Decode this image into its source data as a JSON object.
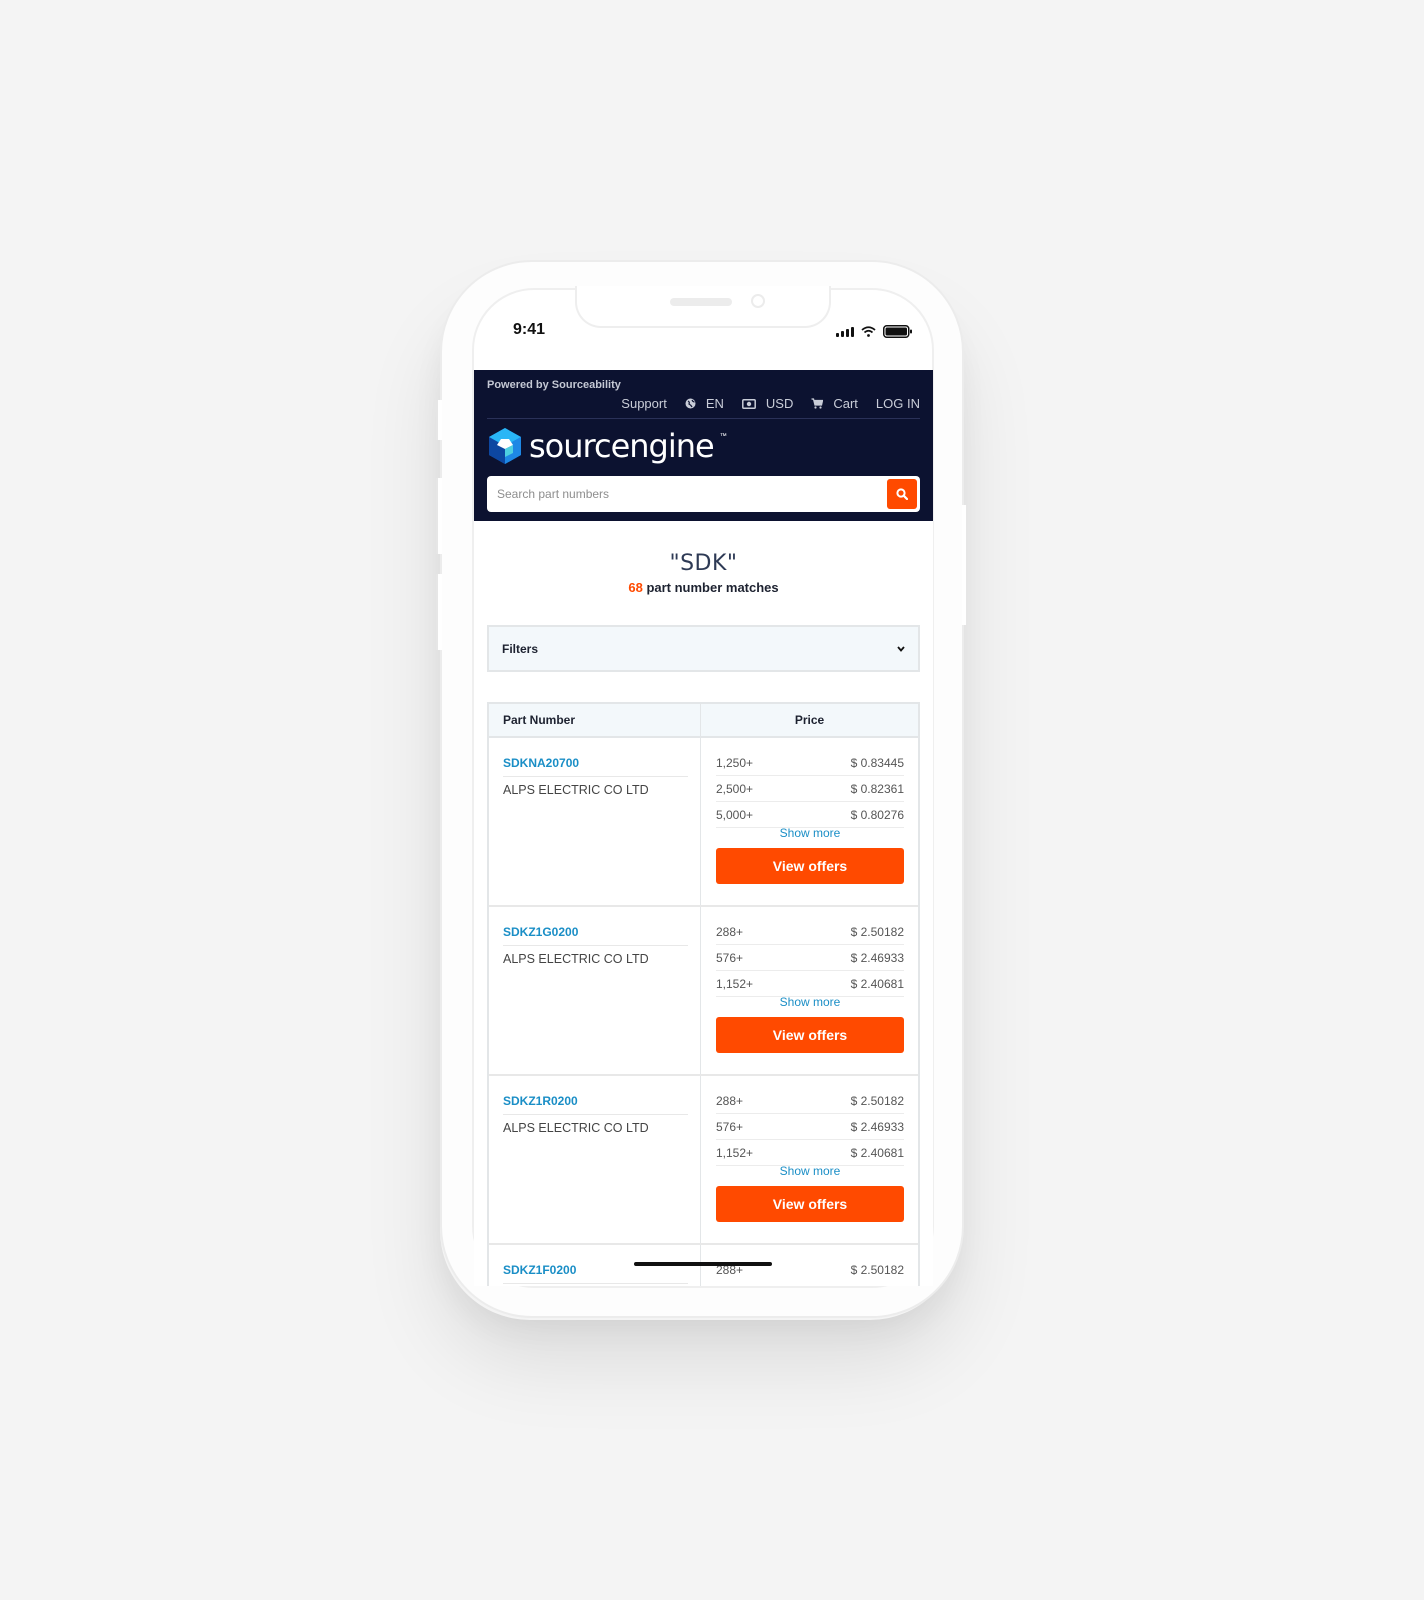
{
  "status_bar": {
    "time": "9:41"
  },
  "header": {
    "powered_by": "Powered by Sourceability",
    "nav": [
      {
        "label": "Support",
        "icon": ""
      },
      {
        "label": "EN",
        "icon": "globe-icon"
      },
      {
        "label": "USD",
        "icon": "money-icon"
      },
      {
        "label": "Cart",
        "icon": "cart-icon"
      },
      {
        "label": "LOG IN",
        "icon": ""
      }
    ],
    "logo_text": "sourcengine",
    "logo_tm": "™",
    "search": {
      "placeholder": "Search part numbers",
      "value": ""
    }
  },
  "results": {
    "query": "\"SDK\"",
    "count": "68",
    "matches_label": "part number matches"
  },
  "filters": {
    "label": "Filters"
  },
  "table": {
    "headers": [
      "Part Number",
      "Price"
    ],
    "show_more_label": "Show more",
    "view_offers_label": "View offers",
    "rows": [
      {
        "part_number": "SDKNA20700",
        "manufacturer": "ALPS ELECTRIC CO LTD",
        "prices": [
          {
            "qty": "1,250+",
            "price": "$ 0.83445"
          },
          {
            "qty": "2,500+",
            "price": "$ 0.82361"
          },
          {
            "qty": "5,000+",
            "price": "$ 0.80276"
          }
        ]
      },
      {
        "part_number": "SDKZ1G0200",
        "manufacturer": "ALPS ELECTRIC CO LTD",
        "prices": [
          {
            "qty": "288+",
            "price": "$ 2.50182"
          },
          {
            "qty": "576+",
            "price": "$ 2.46933"
          },
          {
            "qty": "1,152+",
            "price": "$ 2.40681"
          }
        ]
      },
      {
        "part_number": "SDKZ1R0200",
        "manufacturer": "ALPS ELECTRIC CO LTD",
        "prices": [
          {
            "qty": "288+",
            "price": "$ 2.50182"
          },
          {
            "qty": "576+",
            "price": "$ 2.46933"
          },
          {
            "qty": "1,152+",
            "price": "$ 2.40681"
          }
        ]
      },
      {
        "part_number": "SDKZ1F0200",
        "manufacturer": "",
        "prices": [
          {
            "qty": "288+",
            "price": "$ 2.50182"
          }
        ]
      }
    ]
  },
  "colors": {
    "header_bg": "#0c1230",
    "accent": "#ff4a00",
    "link": "#1a8ec6"
  }
}
